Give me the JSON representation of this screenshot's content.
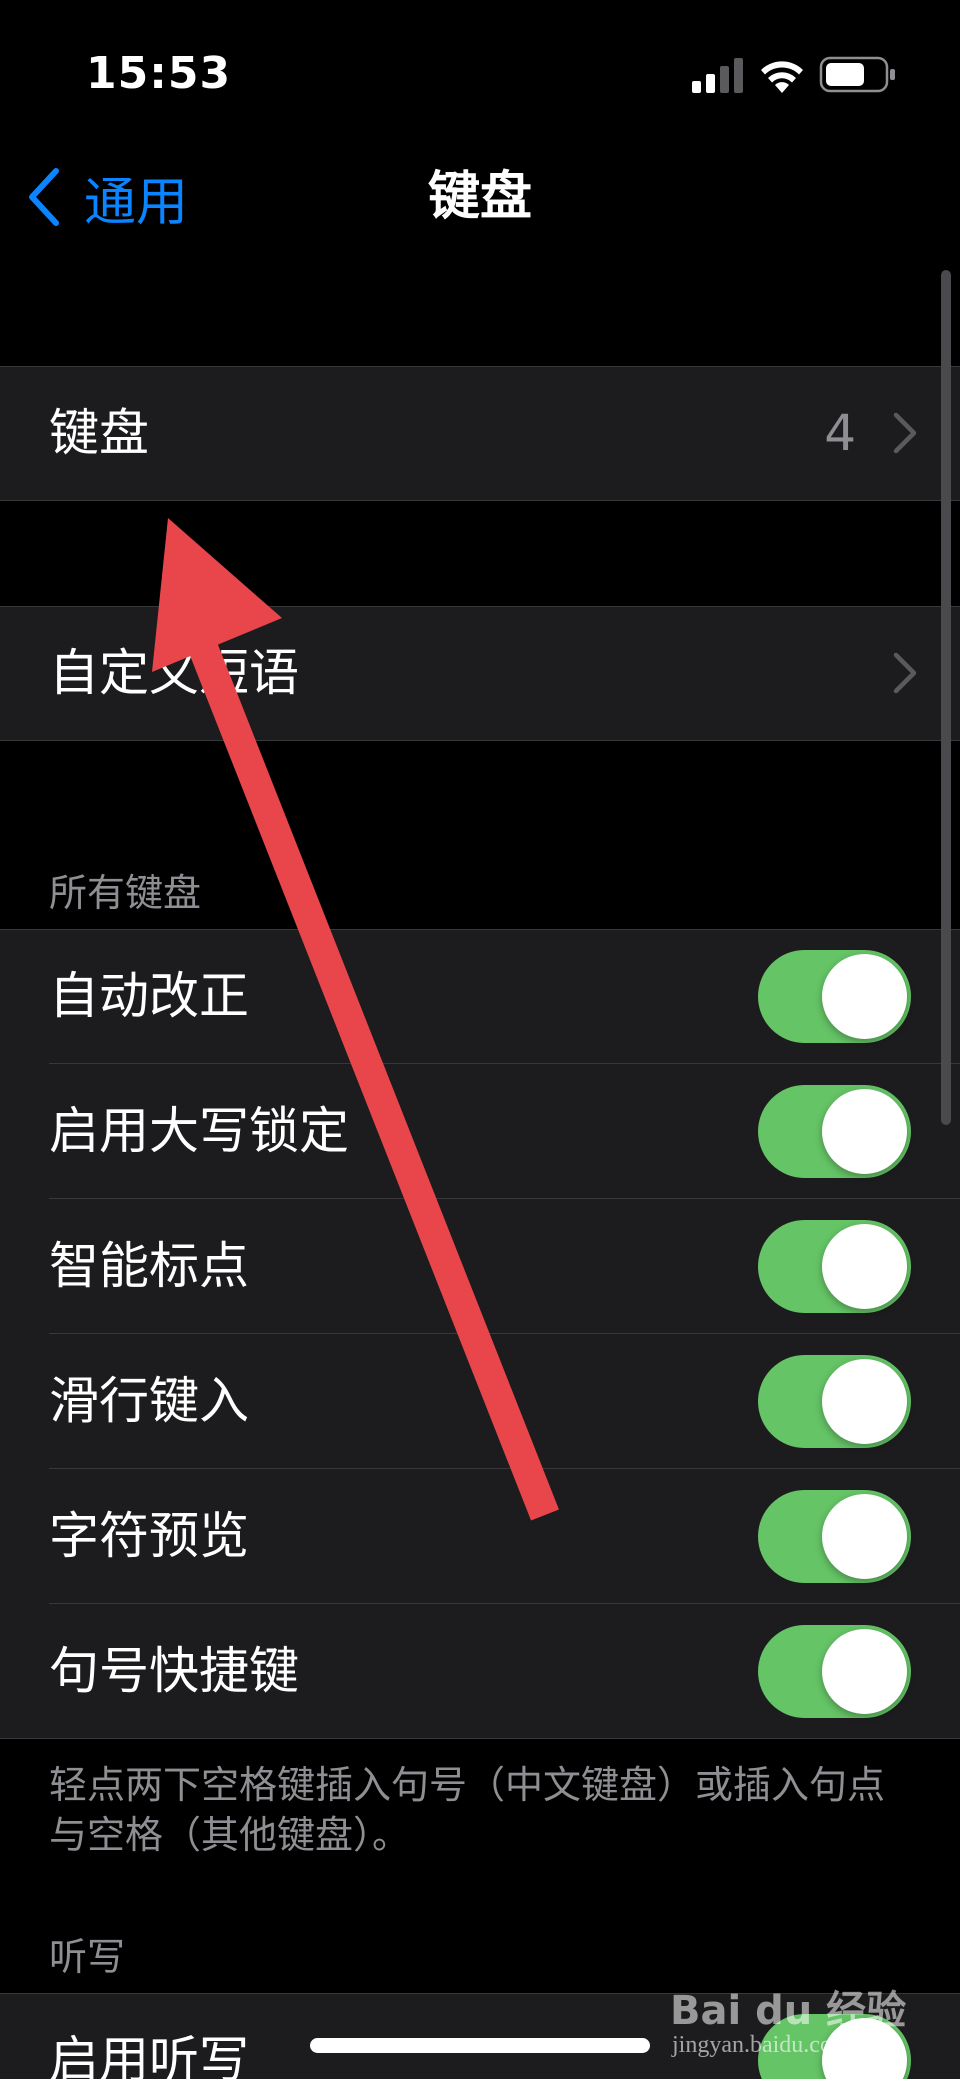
{
  "status_bar": {
    "time": "15:53"
  },
  "nav": {
    "back_label": "通用",
    "title": "键盘"
  },
  "keyboards_row": {
    "label": "键盘",
    "value": "4"
  },
  "text_replacement_row": {
    "label": "自定义短语"
  },
  "all_keyboards": {
    "header": "所有键盘",
    "toggles": [
      {
        "label": "自动改正",
        "on": true
      },
      {
        "label": "启用大写锁定",
        "on": true
      },
      {
        "label": "智能标点",
        "on": true
      },
      {
        "label": "滑行键入",
        "on": true
      },
      {
        "label": "字符预览",
        "on": true
      },
      {
        "label": "句号快捷键",
        "on": true
      }
    ],
    "footer": "轻点两下空格键插入句号（中文键盘）或插入句点与空格（其他键盘）。"
  },
  "dictation": {
    "header": "听写",
    "toggle": {
      "label": "启用听写",
      "on": true
    }
  },
  "watermark": {
    "logo": "Bai du 经验",
    "site": "jingyan.baidu.com"
  },
  "colors": {
    "accent": "#0a84ff",
    "toggle_on": "#65c466",
    "annotation_arrow": "#e8464b"
  },
  "icons": [
    "back-chevron-icon",
    "signal-icon",
    "wifi-icon",
    "battery-icon",
    "chevron-right-icon",
    "annotation-arrow"
  ]
}
